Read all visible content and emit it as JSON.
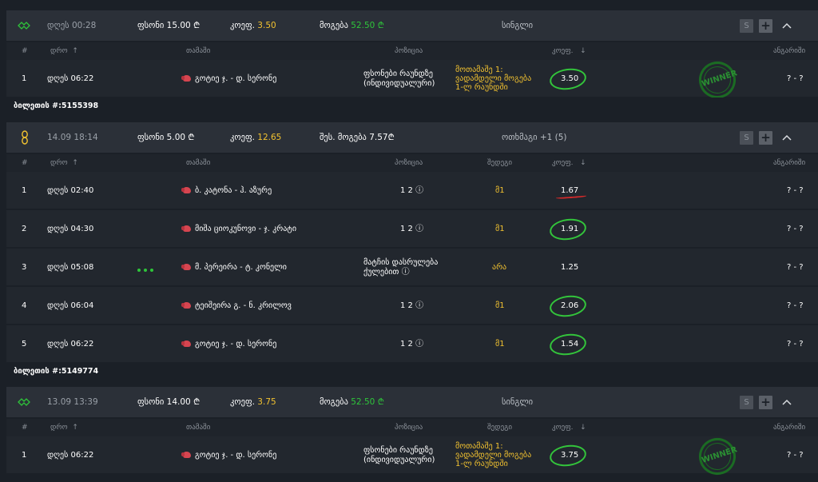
{
  "columns": {
    "num": "#",
    "time": "დრო",
    "sort_up": "↑",
    "match": "თამაში",
    "position": "პოზიცია",
    "pick": "შედეგი",
    "coef": "კოეფ.",
    "sort_down": "↓",
    "result": "ანგარიში"
  },
  "icons": {
    "single": "diamond-outline-icon",
    "express": "chain-link-icon",
    "save": "S",
    "add": "+",
    "collapse": "chevron-up-icon"
  },
  "slips": [
    {
      "date": "დღეს 00:28",
      "stake_label": "ფსონი",
      "stake_value": "15.00 ₾",
      "coef_label": "კოეფ.",
      "coef_value": "3.50",
      "win_label": "მოგება",
      "win_value": "52.50 ₾",
      "type": "სინგლი",
      "ticket_label": "ბილეთის #:5155398",
      "rows": [
        {
          "num": "1",
          "time": "დღეს 06:22",
          "match": "გოტიე ჯ. - დ. სერონე",
          "position_1": "ფსონები რაუნდზე",
          "position_2": "(ინდივიდუალური)",
          "pick_1": "მოთამაშე 1:",
          "pick_2": "ვადამდელი მოგება",
          "pick_3": "1-ლ რაუნდში",
          "coef": "3.50",
          "stamp": "WINNER",
          "result": "? - ?"
        }
      ]
    },
    {
      "date": "14.09 18:14",
      "stake_label": "ფსონი",
      "stake_value": "5.00 ₾",
      "coef_label": "კოეფ.",
      "coef_value": "12.65",
      "win_label": "შეს. მოგება",
      "win_value": "7.57₾",
      "type": "ოთხმაგი +1 (5)",
      "ticket_label": "ბილეთის #:5149774",
      "rows": [
        {
          "num": "1",
          "time": "დღეს 02:40",
          "match": "ბ. კატონა - ჰ. აზურე",
          "position": "1 2 ⓘ",
          "pick": "მ1",
          "coef": "1.67",
          "result": "? - ?"
        },
        {
          "num": "2",
          "time": "დღეს 04:30",
          "match": "მიშა ციოკუნოვი - ჯ. კრატი",
          "position": "1 2 ⓘ",
          "pick": "მ1",
          "coef": "1.91",
          "result": "? - ?"
        },
        {
          "num": "3",
          "time": "დღეს 05:08",
          "match": "მ. პერეირა - ტ. კონელი",
          "position_1": "მატჩის დასრულება",
          "position_2": "ქულებით ⓘ",
          "pick": "არა",
          "coef": "1.25",
          "result": "? - ?"
        },
        {
          "num": "4",
          "time": "დღეს 06:04",
          "match": "ტეიშეირა გ. - ნ. კრილოვ",
          "position": "1 2 ⓘ",
          "pick": "მ1",
          "coef": "2.06",
          "result": "? - ?"
        },
        {
          "num": "5",
          "time": "დღეს 06:22",
          "match": "გოტიე ჯ. - დ. სერონე",
          "position": "1 2 ⓘ",
          "pick": "მ1",
          "coef": "1.54",
          "result": "? - ?"
        }
      ]
    },
    {
      "date": "13.09 13:39",
      "stake_label": "ფსონი",
      "stake_value": "14.00 ₾",
      "coef_label": "კოეფ.",
      "coef_value": "3.75",
      "win_label": "მოგება",
      "win_value": "52.50 ₾",
      "type": "სინგლი",
      "rows": [
        {
          "num": "1",
          "time": "დღეს 06:22",
          "match": "გოტიე ჯ. - დ. სერონე",
          "position_1": "ფსონები რაუნდზე",
          "position_2": "(ინდივიდუალური)",
          "pick_1": "მოთამაშე 1:",
          "pick_2": "ვადამდელი მოგება",
          "pick_3": "1-ლ რაუნდში",
          "coef": "3.75",
          "stamp": "WINNER",
          "result": "? - ?"
        }
      ]
    }
  ]
}
